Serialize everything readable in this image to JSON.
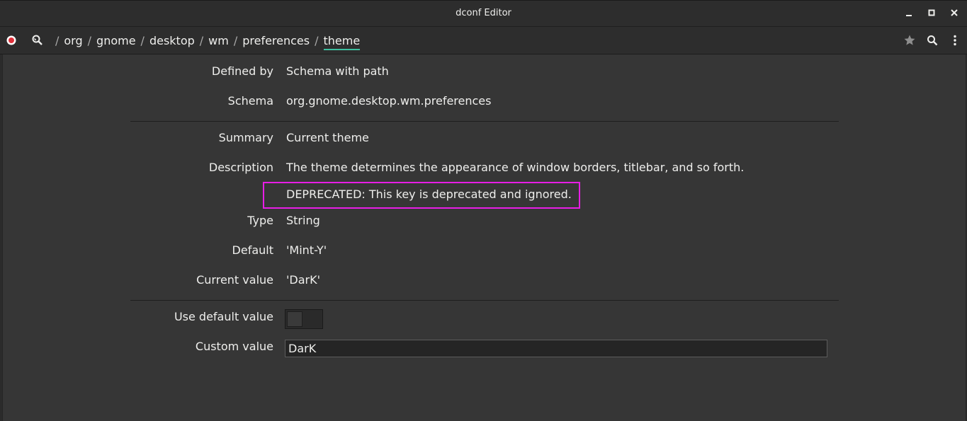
{
  "window": {
    "title": "dconf Editor"
  },
  "header": {
    "breadcrumb": [
      "org",
      "gnome",
      "desktop",
      "wm",
      "preferences",
      "theme"
    ],
    "separator": "/"
  },
  "properties": {
    "defined_by_label": "Defined by",
    "defined_by_value": "Schema with path",
    "schema_label": "Schema",
    "schema_value": "org.gnome.desktop.wm.preferences",
    "summary_label": "Summary",
    "summary_value": "Current theme",
    "description_label": "Description",
    "description_value": "The theme determines the appearance of window borders, titlebar, and so forth.",
    "deprecated_note": "DEPRECATED: This key is deprecated and ignored.",
    "type_label": "Type",
    "type_value": "String",
    "default_label": "Default",
    "default_value": "'Mint-Y'",
    "current_label": "Current value",
    "current_value": "'DarK'"
  },
  "controls": {
    "use_default_label": "Use default value",
    "use_default_on": false,
    "custom_label": "Custom value",
    "custom_value": "DarK"
  },
  "colors": {
    "highlight_border": "#e81ee6",
    "active_underline": "#3dbf9f",
    "record_icon": "#e0303a"
  }
}
